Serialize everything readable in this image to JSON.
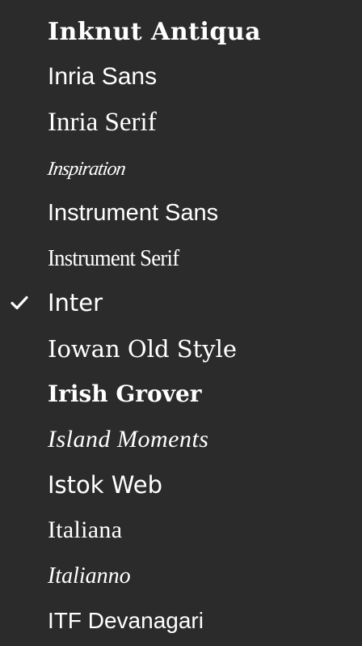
{
  "colors": {
    "background": "#2b2b2b",
    "text": "#ffffff"
  },
  "font_menu": {
    "selected_icon": "checkmark-icon",
    "items": [
      {
        "label": "Inknut Antiqua",
        "selected": false
      },
      {
        "label": "Inria Sans",
        "selected": false
      },
      {
        "label": "Inria Serif",
        "selected": false
      },
      {
        "label": "Inspiration",
        "selected": false
      },
      {
        "label": "Instrument Sans",
        "selected": false
      },
      {
        "label": "Instrument Serif",
        "selected": false
      },
      {
        "label": "Inter",
        "selected": true
      },
      {
        "label": "Iowan Old Style",
        "selected": false
      },
      {
        "label": "Irish Grover",
        "selected": false
      },
      {
        "label": "Island Moments",
        "selected": false
      },
      {
        "label": "Istok Web",
        "selected": false
      },
      {
        "label": "Italiana",
        "selected": false
      },
      {
        "label": "Italianno",
        "selected": false
      },
      {
        "label": "ITF Devanagari",
        "selected": false
      }
    ]
  }
}
